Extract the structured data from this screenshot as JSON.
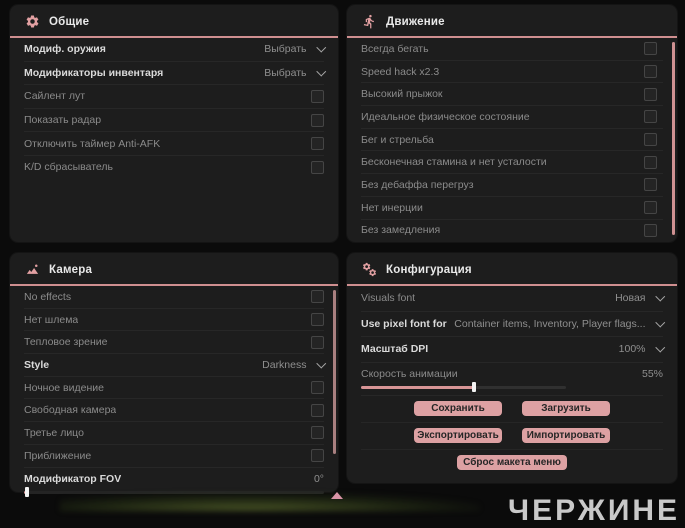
{
  "colors": {
    "accent": "#cf8f90",
    "button": "#dda1a3",
    "panel_bg": "#1d1d1d",
    "page_bg": "#0b0b0b"
  },
  "panels": {
    "general": {
      "title": "Общие",
      "icon": "gear-icon",
      "rows": [
        {
          "label": "Модиф. оружия",
          "type": "dropdown",
          "value": "Выбрать"
        },
        {
          "label": "Модификаторы инвентаря",
          "type": "dropdown",
          "value": "Выбрать"
        },
        {
          "label": "Сайлент лут",
          "type": "checkbox",
          "checked": false
        },
        {
          "label": "Показать радар",
          "type": "checkbox",
          "checked": false
        },
        {
          "label": "Отключить таймер Anti-AFK",
          "type": "checkbox",
          "checked": false
        },
        {
          "label": "K/D сбрасыватель",
          "type": "checkbox",
          "checked": false
        }
      ]
    },
    "movement": {
      "title": "Движение",
      "icon": "runner-icon",
      "rows": [
        {
          "label": "Всегда бегать",
          "type": "checkbox",
          "checked": false
        },
        {
          "label": "Speed hack x2.3",
          "type": "checkbox",
          "checked": false
        },
        {
          "label": "Высокий прыжок",
          "type": "checkbox",
          "checked": false
        },
        {
          "label": "Идеальное физическое состояние",
          "type": "checkbox",
          "checked": false
        },
        {
          "label": "Бег и стрельба",
          "type": "checkbox",
          "checked": false
        },
        {
          "label": "Бесконечная стамина и нет усталости",
          "type": "checkbox",
          "checked": false
        },
        {
          "label": "Без дебаффа перегруз",
          "type": "checkbox",
          "checked": false
        },
        {
          "label": "Нет инерции",
          "type": "checkbox",
          "checked": false
        },
        {
          "label": "Без замедления",
          "type": "checkbox",
          "checked": false
        }
      ]
    },
    "camera": {
      "title": "Камера",
      "icon": "image-icon",
      "rows": [
        {
          "label": "No effects",
          "type": "checkbox",
          "checked": false
        },
        {
          "label": "Нет шлема",
          "type": "checkbox",
          "checked": false
        },
        {
          "label": "Тепловое зрение",
          "type": "checkbox",
          "checked": false
        },
        {
          "label": "Style",
          "type": "dropdown",
          "value": "Darkness"
        },
        {
          "label": "Ночное видение",
          "type": "checkbox",
          "checked": false
        },
        {
          "label": "Свободная камера",
          "type": "checkbox",
          "checked": false
        },
        {
          "label": "Третье лицо",
          "type": "checkbox",
          "checked": false
        },
        {
          "label": "Приближение",
          "type": "checkbox",
          "checked": false
        },
        {
          "label": "Модификатор FOV",
          "type": "slider",
          "value": "0°",
          "fill": 1
        }
      ]
    },
    "config": {
      "title": "Конфигурация",
      "icon": "gears-icon",
      "rows": [
        {
          "label": "Visuals font",
          "type": "dropdown",
          "value": "Новая"
        },
        {
          "label": "Use pixel font for",
          "type": "dropdown",
          "value": "Container items, Inventory, Player flags..."
        },
        {
          "label": "Масштаб DPI",
          "type": "dropdown",
          "value": "100%"
        },
        {
          "label": "Скорость анимации",
          "type": "slider",
          "value": "55%",
          "fill": 55
        }
      ],
      "buttons": {
        "save": "Сохранить",
        "load": "Загрузить",
        "export": "Экспортировать",
        "import": "Импортировать",
        "reset": "Сброс макета меню"
      }
    }
  },
  "watermark": "ЧЕРЖИНЕ"
}
